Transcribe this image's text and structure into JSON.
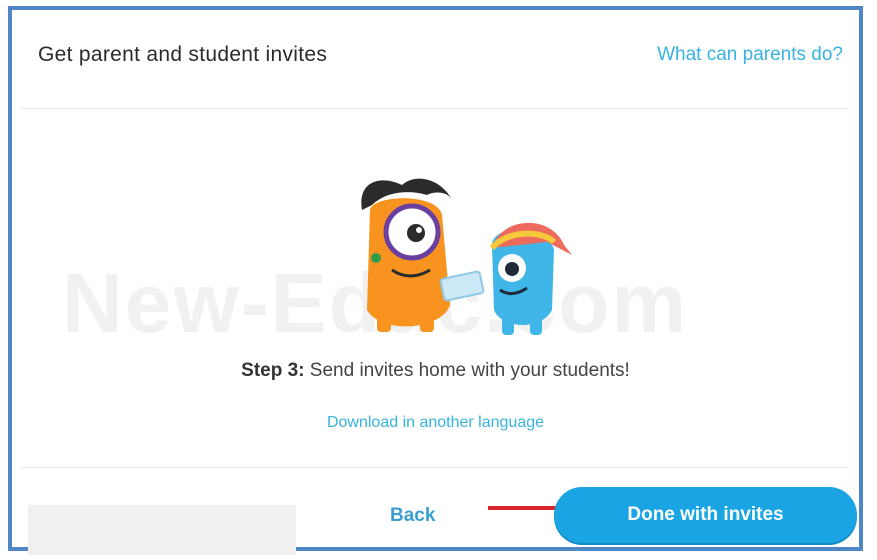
{
  "modal": {
    "title": "Get parent and student invites",
    "help_link": "What can parents do?"
  },
  "watermark": "New-Educ.com",
  "body": {
    "step_label": "Step 3:",
    "step_text": " Send invites home with your students!",
    "download_link": "Download in another language"
  },
  "footer": {
    "back_label": "Back",
    "done_label": "Done with invites"
  },
  "colors": {
    "frame_border": "#4f86c6",
    "link": "#37b3e0",
    "primary_button": "#1ba4e3",
    "annotation_arrow": "#d8242c",
    "monster_orange": "#f7931e",
    "monster_blue": "#3fb5e8"
  },
  "icons": [
    "orange-monster-icon",
    "blue-monster-icon",
    "red-arrow-icon"
  ]
}
